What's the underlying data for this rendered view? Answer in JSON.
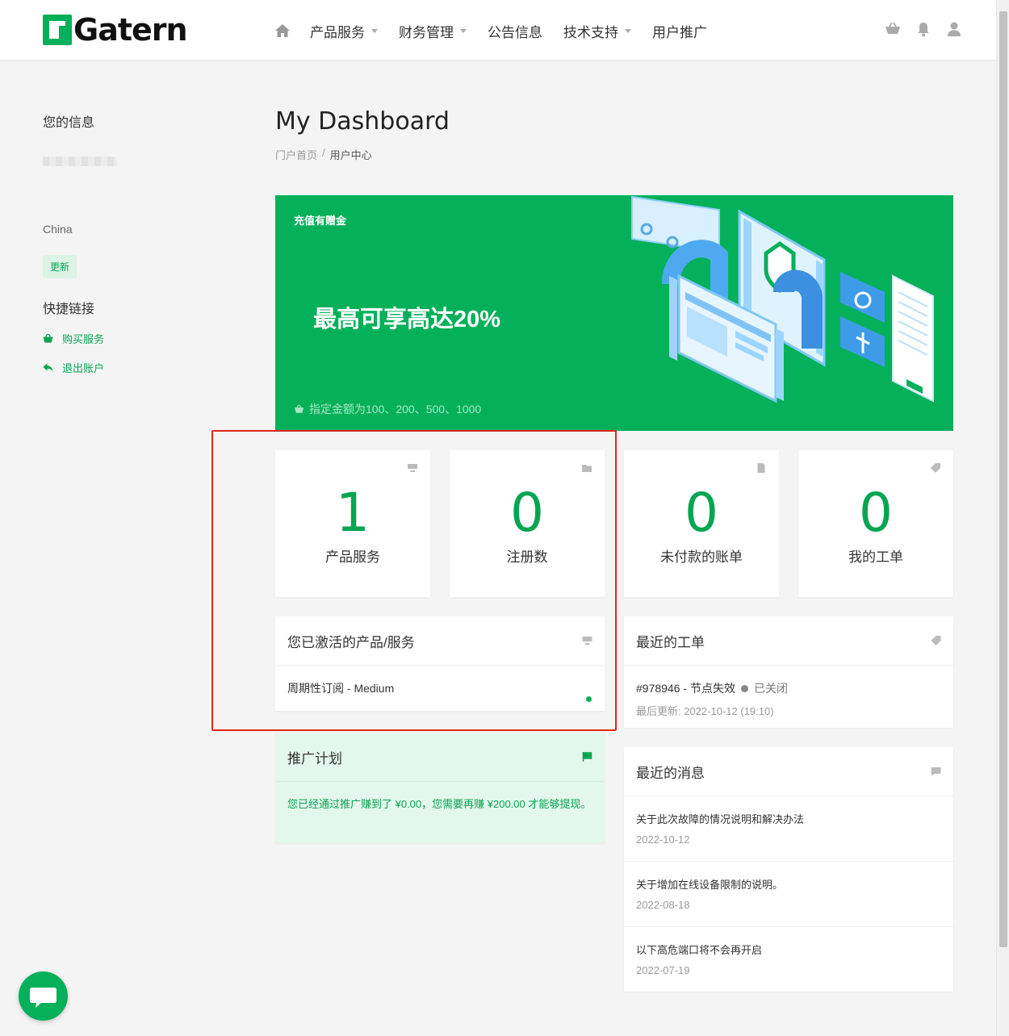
{
  "brand": {
    "name": "Gatern",
    "accent": "#05b05a"
  },
  "nav": {
    "home_icon": "home-icon",
    "items": [
      {
        "label": "产品服务",
        "dropdown": true
      },
      {
        "label": "财务管理",
        "dropdown": true
      },
      {
        "label": "公告信息",
        "dropdown": false
      },
      {
        "label": "技术支持",
        "dropdown": true
      },
      {
        "label": "用户推广",
        "dropdown": false
      }
    ],
    "right_icons": [
      "basket-icon",
      "bell-icon",
      "user-icon"
    ]
  },
  "sidebar": {
    "info_title": "您的信息",
    "country": "China",
    "update_label": "更新",
    "quick_title": "快捷链接",
    "links": [
      {
        "label": "购买服务",
        "icon": "basket-icon"
      },
      {
        "label": "退出账户",
        "icon": "reply-icon"
      }
    ]
  },
  "page": {
    "title": "My Dashboard",
    "breadcrumb": [
      "门户首页",
      "/",
      "用户中心"
    ]
  },
  "banner": {
    "tag": "充值有赠金",
    "headline": "最高可享高达20%",
    "note": "指定金额为100、200、500、1000"
  },
  "stats": [
    {
      "value": "1",
      "label": "产品服务",
      "icon": "monitor-icon"
    },
    {
      "value": "0",
      "label": "注册数",
      "icon": "folder-icon"
    },
    {
      "value": "0",
      "label": "未付款的账单",
      "icon": "document-icon"
    },
    {
      "value": "0",
      "label": "我的工单",
      "icon": "tag-icon"
    }
  ],
  "services_panel": {
    "title": "您已激活的产品/服务",
    "item": "周期性订阅 - Medium"
  },
  "tickets_panel": {
    "title": "最近的工单",
    "ticket": "#978946 - 节点失效",
    "status": "已关闭",
    "updated": "最后更新: 2022-10-12 (19:10)"
  },
  "affiliate_panel": {
    "title": "推广计划",
    "text": "您已经通过推广赚到了 ¥0.00，您需要再赚 ¥200.00 才能够提现。"
  },
  "news_panel": {
    "title": "最近的消息",
    "items": [
      {
        "title": "关于此次故障的情况说明和解决办法",
        "date": "2022-10-12"
      },
      {
        "title": "关于增加在线设备限制的说明。",
        "date": "2022-08-18"
      },
      {
        "title": "以下高危端口将不会再开启",
        "date": "2022-07-19"
      }
    ]
  }
}
